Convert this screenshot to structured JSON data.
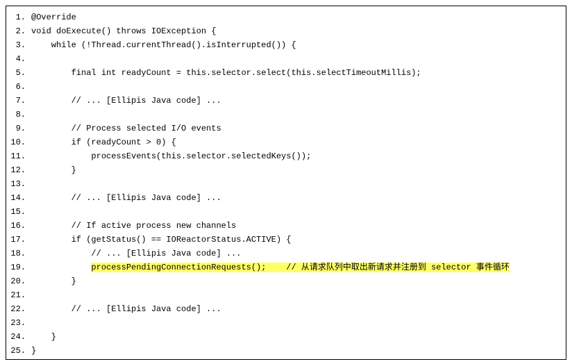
{
  "code_lines": [
    {
      "n": "1.",
      "indent": 0,
      "text": "@Override",
      "highlight": false
    },
    {
      "n": "2.",
      "indent": 0,
      "text": "void doExecute() throws IOException {",
      "highlight": false
    },
    {
      "n": "3.",
      "indent": 1,
      "text": "while (!Thread.currentThread().isInterrupted()) {",
      "highlight": false
    },
    {
      "n": "4.",
      "indent": 1,
      "text": "",
      "highlight": false
    },
    {
      "n": "5.",
      "indent": 2,
      "text": "final int readyCount = this.selector.select(this.selectTimeoutMillis);",
      "highlight": false
    },
    {
      "n": "6.",
      "indent": 2,
      "text": "",
      "highlight": false
    },
    {
      "n": "7.",
      "indent": 2,
      "text": "// ... [Ellipis Java code] ...",
      "highlight": false
    },
    {
      "n": "8.",
      "indent": 2,
      "text": "",
      "highlight": false
    },
    {
      "n": "9.",
      "indent": 2,
      "text": "// Process selected I/O events",
      "highlight": false
    },
    {
      "n": "10.",
      "indent": 2,
      "text": "if (readyCount > 0) {",
      "highlight": false
    },
    {
      "n": "11.",
      "indent": 3,
      "text": "processEvents(this.selector.selectedKeys());",
      "highlight": false
    },
    {
      "n": "12.",
      "indent": 2,
      "text": "}",
      "highlight": false
    },
    {
      "n": "13.",
      "indent": 2,
      "text": "",
      "highlight": false
    },
    {
      "n": "14.",
      "indent": 2,
      "text": "// ... [Ellipis Java code] ...",
      "highlight": false
    },
    {
      "n": "15.",
      "indent": 2,
      "text": "",
      "highlight": false
    },
    {
      "n": "16.",
      "indent": 2,
      "text": "// If active process new channels",
      "highlight": false
    },
    {
      "n": "17.",
      "indent": 2,
      "text": "if (getStatus() == IOReactorStatus.ACTIVE) {",
      "highlight": false
    },
    {
      "n": "18.",
      "indent": 3,
      "text": "// ... [Ellipis Java code] ...",
      "highlight": false
    },
    {
      "n": "19.",
      "indent": 3,
      "text": "processPendingConnectionRequests();    // 从请求队列中取出新请求并注册到 selector 事件循环",
      "highlight": true
    },
    {
      "n": "20.",
      "indent": 2,
      "text": "}",
      "highlight": false
    },
    {
      "n": "21.",
      "indent": 2,
      "text": "",
      "highlight": false
    },
    {
      "n": "22.",
      "indent": 2,
      "text": "// ... [Ellipis Java code] ...",
      "highlight": false
    },
    {
      "n": "23.",
      "indent": 2,
      "text": "",
      "highlight": false
    },
    {
      "n": "24.",
      "indent": 1,
      "text": "}",
      "highlight": false
    },
    {
      "n": "25.",
      "indent": 0,
      "text": "}",
      "highlight": false
    }
  ],
  "indent_unit": "    "
}
